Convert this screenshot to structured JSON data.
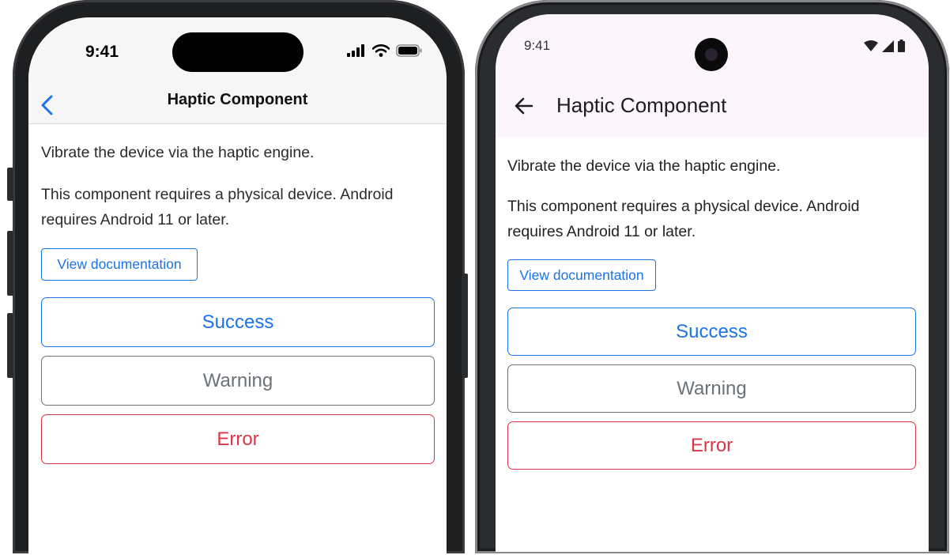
{
  "ios": {
    "status": {
      "time": "9:41",
      "signal_icon": "cellular-signal-icon",
      "wifi_icon": "wifi-icon",
      "battery_icon": "battery-icon"
    },
    "nav": {
      "back_icon": "chevron-left-icon",
      "title": "Haptic Component"
    },
    "content": {
      "description": "Vibrate the device via the haptic engine.",
      "requirement": "This component requires a physical device. Android requires Android 11 or later.",
      "doc_button": "View documentation",
      "buttons": [
        "Success",
        "Warning",
        "Error"
      ]
    }
  },
  "android": {
    "status": {
      "time": "9:41",
      "wifi_icon": "wifi-icon",
      "signal_icon": "cellular-signal-icon",
      "battery_icon": "battery-icon"
    },
    "nav": {
      "back_icon": "arrow-left-icon",
      "title": "Haptic Component"
    },
    "content": {
      "description": "Vibrate the device via the haptic engine.",
      "requirement": "This component requires a physical device. Android requires Android 11 or later.",
      "doc_button": "View documentation",
      "buttons": [
        "Success",
        "Warning",
        "Error"
      ]
    }
  },
  "colors": {
    "primary": "#1a73e8",
    "warning": "#6b7278",
    "error": "#dc3545",
    "android_topbar": "#fdf5fc"
  }
}
